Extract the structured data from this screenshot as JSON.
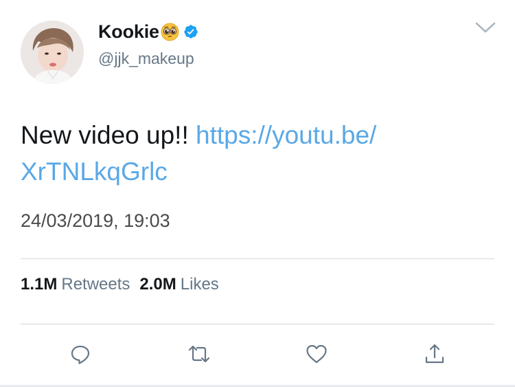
{
  "tweet": {
    "display_name": "Kookie",
    "emoji_name": "pleading-face-emoji",
    "verified": true,
    "handle": "@jjk_makeup",
    "text": "New video up!! ",
    "link": "https://youtu.be/XrTNLkqGrlc",
    "link_line1": "https://youtu.be/",
    "link_line2": "XrTNLkqGrlc",
    "timestamp": "24/03/2019, 19:03",
    "retweets_count": "1.1M",
    "retweets_label": "Retweets",
    "likes_count": "2.0M",
    "likes_label": "Likes"
  },
  "actions": [
    {
      "name": "reply",
      "icon": "reply-icon"
    },
    {
      "name": "retweet",
      "icon": "retweet-icon"
    },
    {
      "name": "like",
      "icon": "heart-icon"
    },
    {
      "name": "share",
      "icon": "share-icon"
    }
  ],
  "colors": {
    "link": "#5aa8e6",
    "verified": "#1da1f2",
    "secondary_text": "#657786",
    "icon": "#657786"
  }
}
